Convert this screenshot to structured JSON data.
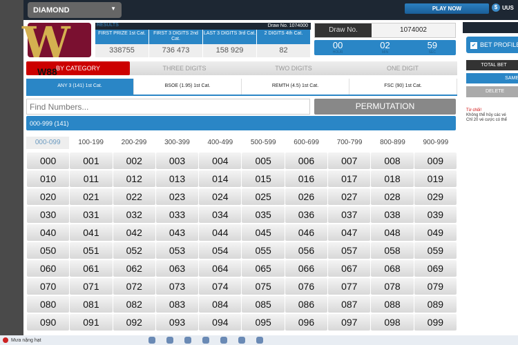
{
  "topbar": {
    "game": "DIAMOND",
    "play_now": "PLAY NOW",
    "user": "UUS",
    "coin_symbol": "$"
  },
  "logo": {
    "text": "W88"
  },
  "results": {
    "label": "RESULTS",
    "draw_no": "Draw No. 1074000",
    "columns": [
      {
        "header": "FIRST PRIZE 1st Cat.",
        "value": "338755"
      },
      {
        "header": "FIRST 3 DIGITS 2nd Cat.",
        "value": "736   473"
      },
      {
        "header": "LAST 3 DIGITS 3rd Cat.",
        "value": "158   929"
      },
      {
        "header": "2 DIGITS 4th Cat.",
        "value": "82"
      }
    ]
  },
  "draw": {
    "label": "Draw No.",
    "value": "1074002"
  },
  "timer": [
    {
      "value": "00",
      "unit": "HOUR"
    },
    {
      "value": "02",
      "unit": "MIN"
    },
    {
      "value": "59",
      "unit": "SEC"
    }
  ],
  "category_tabs": [
    "BY CATEGORY",
    "THREE DIGITS",
    "TWO DIGITS",
    "ONE DIGIT"
  ],
  "sub_tabs": [
    "ANY 3 (141) 1st Cat.",
    "BSOE (1.95) 1st Cat.",
    "REMTH (4.5) 1st Cat.",
    "FSC (90) 1st Cat."
  ],
  "find": {
    "placeholder": "Find Numbers..."
  },
  "permutation": "PERMUTATION",
  "range_bar": "000-999 (141)",
  "range_tabs": [
    "000-099",
    "100-199",
    "200-299",
    "300-399",
    "400-499",
    "500-599",
    "600-699",
    "700-799",
    "800-899",
    "900-999"
  ],
  "numbers": [
    "000",
    "001",
    "002",
    "003",
    "004",
    "005",
    "006",
    "007",
    "008",
    "009",
    "010",
    "011",
    "012",
    "013",
    "014",
    "015",
    "016",
    "017",
    "018",
    "019",
    "020",
    "021",
    "022",
    "023",
    "024",
    "025",
    "026",
    "027",
    "028",
    "029",
    "030",
    "031",
    "032",
    "033",
    "034",
    "035",
    "036",
    "037",
    "038",
    "039",
    "040",
    "041",
    "042",
    "043",
    "044",
    "045",
    "046",
    "047",
    "048",
    "049",
    "050",
    "051",
    "052",
    "053",
    "054",
    "055",
    "056",
    "057",
    "058",
    "059",
    "060",
    "061",
    "062",
    "063",
    "064",
    "065",
    "066",
    "067",
    "068",
    "069",
    "070",
    "071",
    "072",
    "073",
    "074",
    "075",
    "076",
    "077",
    "078",
    "079",
    "080",
    "081",
    "082",
    "083",
    "084",
    "085",
    "086",
    "087",
    "088",
    "089",
    "090",
    "091",
    "092",
    "093",
    "094",
    "095",
    "096",
    "097",
    "098",
    "099"
  ],
  "right": {
    "bet_profile": "BET PROFILE",
    "total_bet": "TOTAL BET",
    "same": "SAME",
    "delete": "DELETE",
    "note_title": "Từ chối!",
    "note_lines": [
      "Không thể hủy các vé",
      "Chỉ 20 vé cược có thể"
    ]
  },
  "taskbar": {
    "weather": "Mưa nặng hạt"
  },
  "colors": {
    "accent": "#2a86c6",
    "active_category": "#cc0000",
    "topbar": "#1d2733"
  }
}
